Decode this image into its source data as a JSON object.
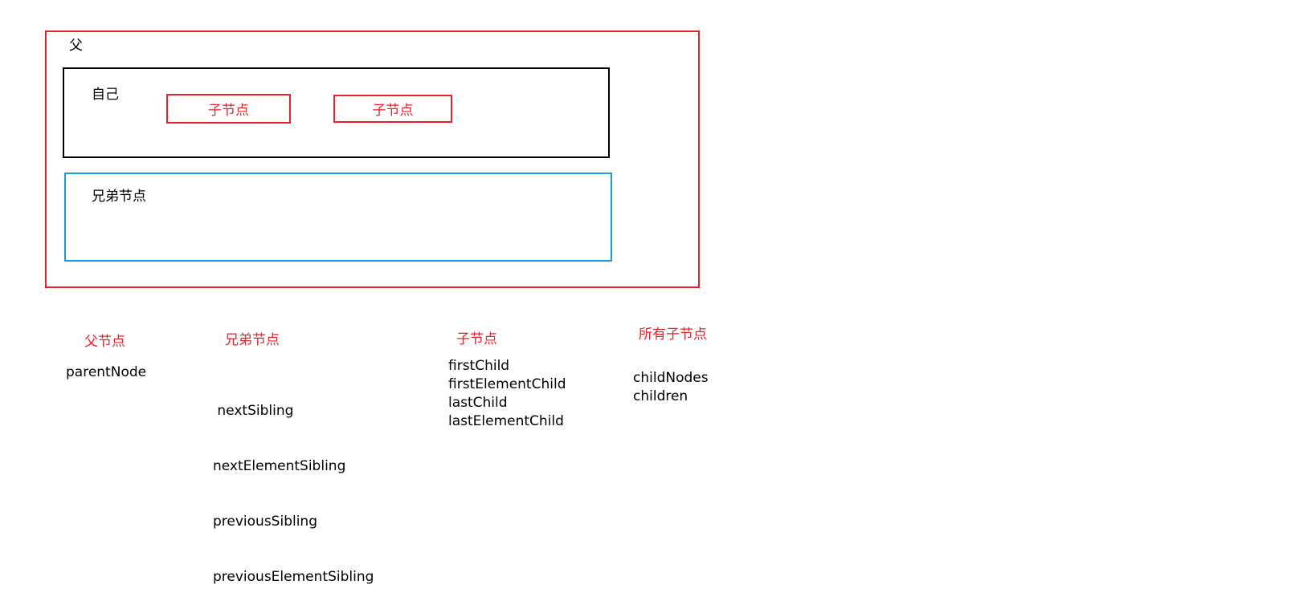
{
  "diagram": {
    "parent_label": "父",
    "self_label": "自己",
    "child_labels": [
      "子节点",
      "子节点"
    ],
    "sibling_label": "兄弟节点"
  },
  "legend": {
    "parent": {
      "heading": "父节点",
      "properties": [
        "parentNode"
      ]
    },
    "siblings": {
      "heading": "兄弟节点",
      "properties": [
        " nextSibling",
        "nextElementSibling",
        "previousSibling",
        "previousElementSibling"
      ]
    },
    "children": {
      "heading": "子节点",
      "properties": [
        "firstChild",
        "firstElementChild",
        "lastChild",
        "lastElementChild"
      ]
    },
    "all_children": {
      "heading": "所有子节点",
      "properties": [
        "childNodes",
        "children"
      ]
    }
  },
  "colors": {
    "red": "#e8202a",
    "black": "#000000",
    "blue": "#1a9ae0"
  }
}
